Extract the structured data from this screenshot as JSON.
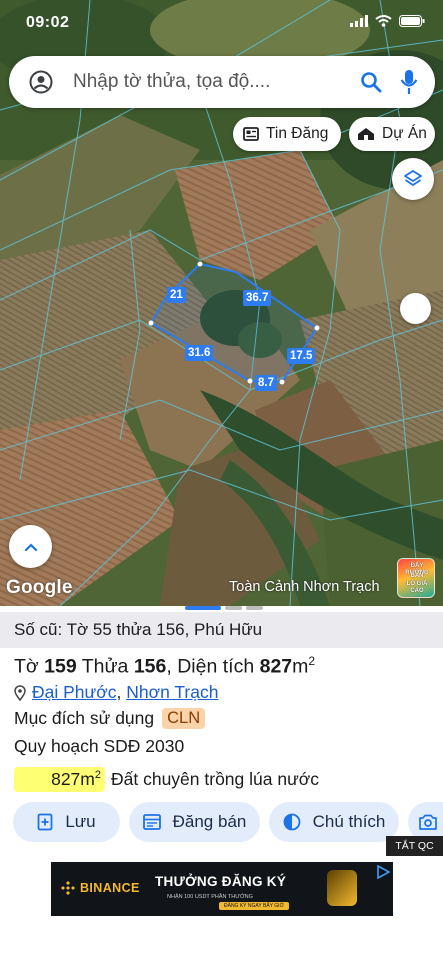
{
  "status_bar": {
    "time": "09:02"
  },
  "search": {
    "placeholder": "Nhập tờ thửa, tọa độ...."
  },
  "chips": {
    "tin_dang": "Tin Đăng",
    "du_an": "Dự Án"
  },
  "plot": {
    "edges": [
      "21",
      "36.7",
      "17.5",
      "8.7",
      "31.6"
    ]
  },
  "map": {
    "logo": "Google",
    "caption": "Toàn Cảnh Nhơn Trạch",
    "promo_lines": [
      "ĐẤY RƯỜNG",
      "BÁN",
      "LÔ GIÁ CAO"
    ]
  },
  "parcel": {
    "old_info": "Số cũ: Tờ 55 thửa 156, Phú Hữu",
    "sheet_label": "Tờ",
    "sheet_number": "159",
    "parcel_label": "Thửa",
    "parcel_number": "156",
    "area_label": ", Diện tích",
    "area_value": "827",
    "area_unit": "m",
    "area_unit_sup": "2",
    "ward": "Đại Phước",
    "district": "Nhơn Trạch",
    "separator": ",",
    "purpose_label": "Mục đích sử dụng",
    "purpose_code": "CLN",
    "planning": "Quy hoạch SDĐ 2030",
    "zone_area": "827m",
    "zone_area_sup": "2",
    "zone_desc": "Đất chuyên trồng lúa nước"
  },
  "actions": {
    "save": "Lưu",
    "sell": "Đăng bán",
    "legend": "Chú thích"
  },
  "ad": {
    "close": "TẮT QC",
    "brand": "BINANCE",
    "title": "THƯỞNG ĐĂNG KÝ",
    "subtitle": "NHẬN 100 USDT PHẦN THƯỞNG",
    "cta": "ĐĂNG KÝ NGAY BÂY GIỜ"
  },
  "colors": {
    "plot_line": "#2d7cf0",
    "accent": "#1a5fd0",
    "zone": "#ffff73",
    "cln": "#fbd3a8",
    "action_bg": "#e3ecfb"
  }
}
